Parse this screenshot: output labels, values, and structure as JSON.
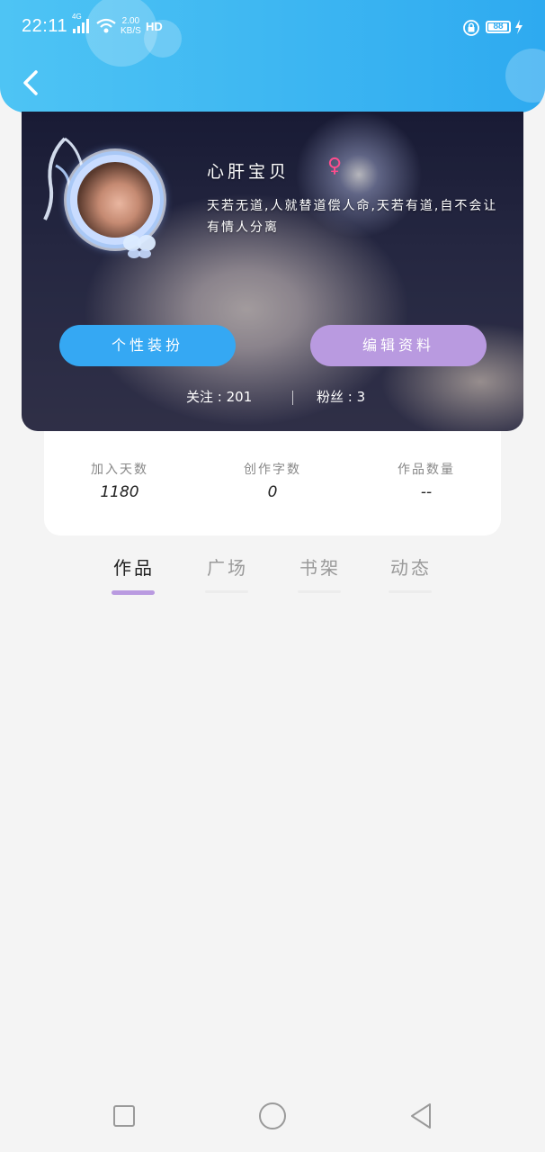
{
  "status_bar": {
    "time": "22:11",
    "network": "4G",
    "net_speed_value": "2.00",
    "net_speed_unit": "KB/S",
    "hd_label": "HD",
    "battery_level": "88"
  },
  "header": {
    "back_icon": "chevron-left-icon",
    "color": "#2eaaf0"
  },
  "profile": {
    "nickname": "心肝宝贝",
    "gender_symbol": "♀",
    "bio": "天若无道,人就替道偿人命,天若有道,自不会让有情人分离",
    "buttons": {
      "dress_up": "个性装扮",
      "edit_profile": "编辑资料"
    },
    "follow_label": "关注",
    "follow_count": "201",
    "fans_label": "粉丝",
    "fans_count": "3",
    "colors": {
      "dress_up_button": "#35a8f3",
      "edit_button": "#b99ae0",
      "gender": "#ff4d8d"
    }
  },
  "info": [
    {
      "label": "加入天数",
      "value": "1180"
    },
    {
      "label": "创作字数",
      "value": "0"
    },
    {
      "label": "作品数量",
      "value": "--"
    }
  ],
  "tabs": [
    {
      "label": "作品",
      "active": true
    },
    {
      "label": "广场",
      "active": false
    },
    {
      "label": "书架",
      "active": false
    },
    {
      "label": "动态",
      "active": false
    }
  ],
  "tab_indicator_color": "#b99ae0",
  "nav_bar": {
    "recent_icon": "square-icon",
    "home_icon": "circle-icon",
    "back_icon": "triangle-back-icon"
  }
}
